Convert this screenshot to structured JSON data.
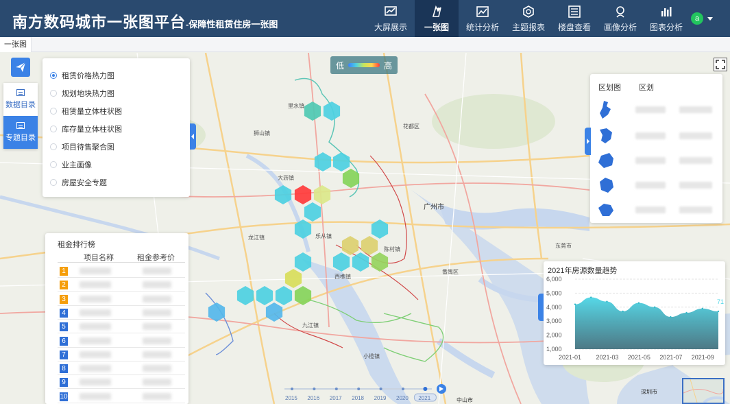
{
  "header": {
    "title": "南方数码城市一张图平台",
    "subtitle": "-保障性租赁住房一张图"
  },
  "nav": [
    {
      "label": "大屏展示",
      "icon": "monitor-chart-icon"
    },
    {
      "label": "一张图",
      "icon": "map-pin-icon",
      "active": true
    },
    {
      "label": "统计分析",
      "icon": "line-chart-icon"
    },
    {
      "label": "主题报表",
      "icon": "hexagon-report-icon"
    },
    {
      "label": "楼盘查看",
      "icon": "building-grid-icon"
    },
    {
      "label": "画像分析",
      "icon": "portrait-icon"
    },
    {
      "label": "图表分析",
      "icon": "bar-chart-icon"
    }
  ],
  "user": {
    "initial": "a"
  },
  "breadcrumb": "一张图",
  "side_tabs": [
    {
      "label": "数据目录"
    },
    {
      "label": "专题目录",
      "active": true
    }
  ],
  "layers": [
    {
      "label": "租赁价格热力图",
      "checked": true
    },
    {
      "label": "规划地块热力图"
    },
    {
      "label": "租赁量立体柱状图"
    },
    {
      "label": "库存量立体柱状图"
    },
    {
      "label": "项目待售聚合图"
    },
    {
      "label": "业主画像"
    },
    {
      "label": "房屋安全专题"
    }
  ],
  "legend": {
    "low": "低",
    "high": "高",
    "colors": [
      "#3b82ff",
      "#4dd0e1",
      "#c8e65a",
      "#ffd54f",
      "#ff3b3b"
    ]
  },
  "district_panel": {
    "col1": "区划图",
    "col2": "区划"
  },
  "ranking": {
    "title": "租金排行榜",
    "col_name": "项目名称",
    "col_price": "租金参考价",
    "rows": [
      "1",
      "2",
      "3",
      "4",
      "5",
      "6",
      "7",
      "8",
      "9",
      "10"
    ],
    "top_color": "#f59e0b",
    "other_color": "#2f6fd6"
  },
  "trend": {
    "title": "2021年房源数量趋势",
    "edge_value": "71"
  },
  "chart_data": {
    "type": "area",
    "title": "2021年房源数量趋势",
    "x": [
      "2021-01",
      "2021-02",
      "2021-03",
      "2021-04",
      "2021-05",
      "2021-06",
      "2021-07",
      "2021-08",
      "2021-09",
      "2021-10"
    ],
    "values": [
      4200,
      4700,
      4400,
      3700,
      4300,
      4000,
      3300,
      3600,
      3900,
      3700
    ],
    "yticks": [
      "1,000",
      "2,000",
      "3,000",
      "4,000",
      "5,000",
      "6,000"
    ],
    "xticks": [
      "2021-01",
      "2021-03",
      "2021-05",
      "2021-07",
      "2021-09"
    ],
    "ylim": [
      1000,
      6000
    ],
    "color": "#4dd6e6"
  },
  "timeline": {
    "years": [
      "2015",
      "2016",
      "2017",
      "2018",
      "2019",
      "2020",
      "2021"
    ],
    "current": "2021"
  },
  "map_labels": {
    "guangzhou": "广州市",
    "huadou": "花都区",
    "panyu": "番禺区",
    "dongguan": "东莞市",
    "shenzhen": "深圳市",
    "zhongshan": "中山市",
    "dali": "大沥镇",
    "xiqiao": "西樵镇",
    "lishui": "里水镇",
    "shishan": "狮山镇",
    "jiujiang": "九江镇",
    "longjiang": "龙江镇",
    "lecong": "乐从镇",
    "xiaolan": "小榄镇",
    "chencun": "陈村镇"
  }
}
